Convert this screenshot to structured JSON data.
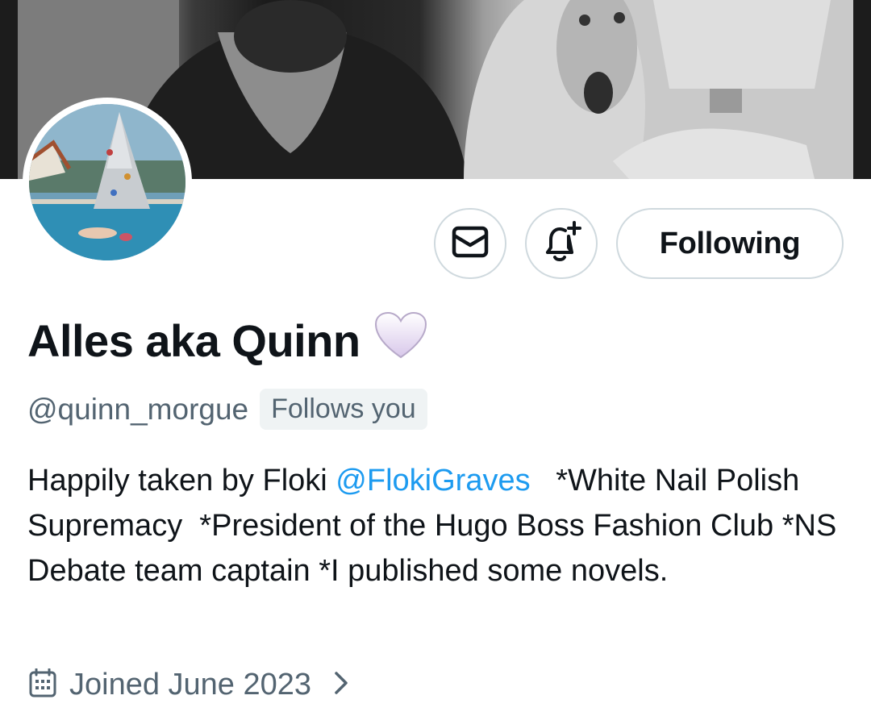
{
  "header": {
    "banner_alt": "",
    "avatar_alt": ""
  },
  "actions": {
    "message_icon": "envelope-icon",
    "notify_icon": "bell-plus-icon",
    "following_label": "Following"
  },
  "profile": {
    "display_name": "Alles aka Quinn",
    "name_emoji": "white-heart-icon",
    "handle": "@quinn_morgue",
    "follows_you_badge": "Follows you",
    "bio_part1": "Happily taken by Floki ",
    "bio_mention": "@FlokiGraves",
    "bio_part2": "   *White Nail Polish Supremacy  *President of the Hugo Boss Fashion Club *NS Debate team captain *I published some novels.",
    "joined_icon": "calendar-icon",
    "joined_text": "Joined June 2023"
  },
  "colors": {
    "accent": "#1d9bf0",
    "secondary_text": "#536471",
    "border": "#cfd9de",
    "badge_bg": "#eff3f4"
  }
}
